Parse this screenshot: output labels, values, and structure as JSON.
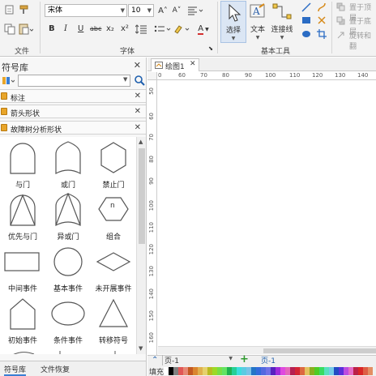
{
  "ribbon": {
    "font_name": "宋体",
    "font_size": "10",
    "grow_font": "A˄",
    "shrink_font": "A˅",
    "format_buttons": [
      "B",
      "I",
      "U",
      "abc",
      "x₂",
      "x²"
    ],
    "groups": {
      "file": "文件",
      "font": "字体",
      "basic_tools": "基本工具"
    },
    "select_label": "选择",
    "text_label": "文本",
    "connector_label": "连接线",
    "arrange": {
      "bring_to_top": "置于顶层",
      "send_to_bottom": "置于底层",
      "rotate_flip": "旋转和翻"
    }
  },
  "library": {
    "title": "符号库",
    "search_placeholder": "",
    "categories": [
      {
        "label": "标注"
      },
      {
        "label": "箭头形状"
      },
      {
        "label": "故障树分析形状"
      }
    ],
    "shapes": [
      {
        "label": "与门",
        "icon": "and-gate"
      },
      {
        "label": "或门",
        "icon": "or-gate"
      },
      {
        "label": "禁止门",
        "icon": "inhibit-gate"
      },
      {
        "label": "优先与门",
        "icon": "priority-and-gate"
      },
      {
        "label": "异或门",
        "icon": "xor-gate"
      },
      {
        "label": "组合",
        "icon": "combination",
        "inner_text": "n"
      },
      {
        "label": "中间事件",
        "icon": "intermediate-event"
      },
      {
        "label": "基本事件",
        "icon": "basic-event"
      },
      {
        "label": "未开展事件",
        "icon": "undeveloped-event"
      },
      {
        "label": "初始事件",
        "icon": "initial-event"
      },
      {
        "label": "条件事件",
        "icon": "conditional-event"
      },
      {
        "label": "转移符号",
        "icon": "transfer-symbol"
      }
    ],
    "tabs": [
      {
        "label": "符号库"
      },
      {
        "label": "文件恢复"
      }
    ]
  },
  "document": {
    "tab_title": "绘图1",
    "ruler_h": [
      "0",
      "60",
      "70",
      "80",
      "90",
      "100",
      "110",
      "120",
      "130",
      "140"
    ],
    "ruler_v": [
      "50",
      "60",
      "70",
      "80",
      "90",
      "100",
      "110",
      "120",
      "130",
      "140",
      "150",
      "160"
    ],
    "page_selector": "页-1",
    "page_tab": "页-1",
    "fill_label": "填充"
  },
  "colors": {
    "accent": "#2b6cc4",
    "folder": "#e8a52a",
    "add_page": "#2f9a2f"
  }
}
